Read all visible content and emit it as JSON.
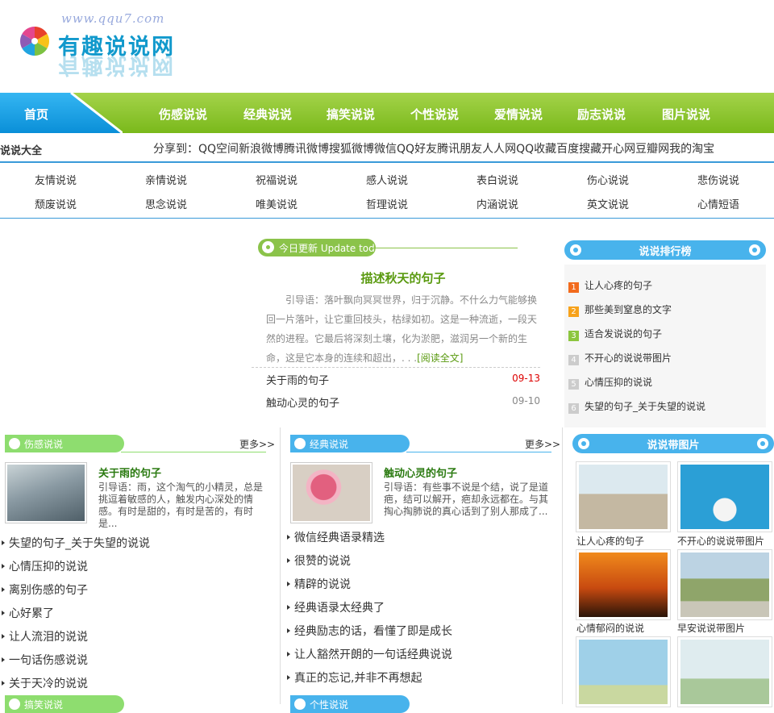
{
  "logo": {
    "url": "www.qqu7.com",
    "text": "有趣说说网"
  },
  "nav": {
    "home": "首页",
    "items": [
      "伤感说说",
      "经典说说",
      "搞笑说说",
      "个性说说",
      "爱情说说",
      "励志说说",
      "图片说说"
    ]
  },
  "bar2": {
    "title": "说说大全",
    "share": "分享到：QQ空间新浪微博腾讯微博搜狐微博微信QQ好友腾讯朋友人人网QQ收藏百度搜藏开心网豆瓣网我的淘宝"
  },
  "categories": [
    [
      "友情说说",
      "亲情说说",
      "祝福说说",
      "感人说说",
      "表白说说",
      "伤心说说",
      "悲伤说说"
    ],
    [
      "颓废说说",
      "思念说说",
      "唯美说说",
      "哲理说说",
      "内涵说说",
      "英文说说",
      "心情短语"
    ]
  ],
  "today": {
    "label": "今日更新 Update today",
    "featured_title": "描述秋天的句子",
    "featured_excerpt": "引导语：落叶飘向冥冥世界，归于沉静。不什么力气能够换回一片落叶，让它重回枝头，枯绿如初。这是一种流逝，一段天然的进程。它最后将深刻土壤，化为淤肥，滋润另一个新的生命，这是它本身的连续和超出，. . .",
    "featured_more": "[阅读全文]",
    "rows": [
      {
        "title": "关于雨的句子",
        "date": "09-13"
      },
      {
        "title": "触动心灵的句子",
        "date": "09-10"
      }
    ]
  },
  "rank": {
    "title": "说说排行榜",
    "items": [
      "让人心疼的句子",
      "那些美到窒息的文字",
      "适合发说说的句子",
      "不开心的说说带图片",
      "心情压抑的说说",
      "失望的句子_关于失望的说说"
    ]
  },
  "sections": {
    "sad": {
      "title": "伤感说说",
      "more": "更多>>",
      "card_title": "关于雨的句子",
      "card_excerpt": "引导语：雨，这个淘气的小精灵，总是挑逗着敏感的人，触发内心深处的情感。有时是甜的，有时是苦的，有时是...",
      "items": [
        "失望的句子_关于失望的说说",
        "心情压抑的说说",
        "离别伤感的句子",
        "心好累了",
        "让人流泪的说说",
        "一句话伤感说说",
        "关于天冷的说说"
      ]
    },
    "classic": {
      "title": "经典说说",
      "more": "更多>>",
      "card_title": "触动心灵的句子",
      "card_excerpt": "引导语：有些事不说是个结，说了是道疤，结可以解开，疤却永远都在。与其掏心掏肺说的真心话到了别人那成了...",
      "items": [
        "微信经典语录精选",
        "很赞的说说",
        "精辟的说说",
        "经典语录太经典了",
        "经典励志的话，看懂了即是成长",
        "让人豁然开朗的一句话经典说说",
        "真正的忘记,并非不再想起"
      ]
    },
    "pics": {
      "title": "说说带图片",
      "items": [
        "让人心疼的句子",
        "不开心的说说带图片",
        "心情郁闷的说说",
        "早安说说带图片"
      ]
    },
    "next_left": "搞笑说说",
    "next_mid": "个性说说"
  },
  "colors": {
    "green": "#8bc34a",
    "blue": "#48b3ec",
    "nav_home": "#1aa0e8"
  }
}
